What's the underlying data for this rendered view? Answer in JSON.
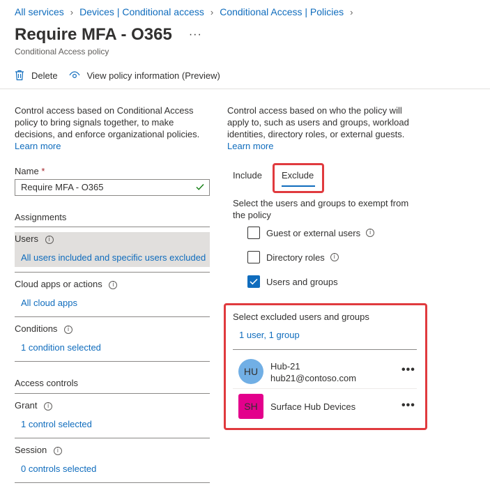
{
  "breadcrumb": {
    "items": [
      "All services",
      "Devices | Conditional access",
      "Conditional Access | Policies"
    ]
  },
  "header": {
    "title": "Require MFA - O365",
    "more": "···",
    "subtitle": "Conditional Access policy"
  },
  "toolbar": {
    "delete_label": "Delete",
    "view_info_label": "View policy information (Preview)"
  },
  "left": {
    "description": "Control access based on Conditional Access policy to bring signals together, to make decisions, and enforce organizational policies.",
    "learn_more": "Learn more",
    "name_label": "Name",
    "name_required": "*",
    "name_value": "Require MFA - O365",
    "assignments_heading": "Assignments",
    "users_label": "Users",
    "users_value": "All users included and specific users excluded",
    "cloud_apps_label": "Cloud apps or actions",
    "cloud_apps_value": "All cloud apps",
    "conditions_label": "Conditions",
    "conditions_value": "1 condition selected",
    "access_controls_heading": "Access controls",
    "grant_label": "Grant",
    "grant_value": "1 control selected",
    "session_label": "Session",
    "session_value": "0 controls selected"
  },
  "right": {
    "description": "Control access based on who the policy will apply to, such as users and groups, workload identities, directory roles, or external guests.",
    "learn_more": "Learn more",
    "tabs": {
      "include": "Include",
      "exclude": "Exclude"
    },
    "exempt_text": "Select the users and groups to exempt from the policy",
    "options": [
      {
        "label": "Guest or external users",
        "checked": false,
        "info": true
      },
      {
        "label": "Directory roles",
        "checked": false,
        "info": true
      },
      {
        "label": "Users and groups",
        "checked": true,
        "info": false
      }
    ],
    "excluded_heading": "Select excluded users and groups",
    "excluded_summary": "1 user, 1 group",
    "excluded_items": [
      {
        "initials": "HU",
        "name": "Hub-21",
        "email": "hub21@contoso.com",
        "more": "•••"
      },
      {
        "initials": "SH",
        "name": "Surface Hub Devices",
        "more": "•••"
      }
    ]
  },
  "colors": {
    "accent": "#0f6cbd",
    "highlight_border": "#e03a3e",
    "avatar_user": "#71afe5",
    "avatar_group": "#e3008c"
  }
}
